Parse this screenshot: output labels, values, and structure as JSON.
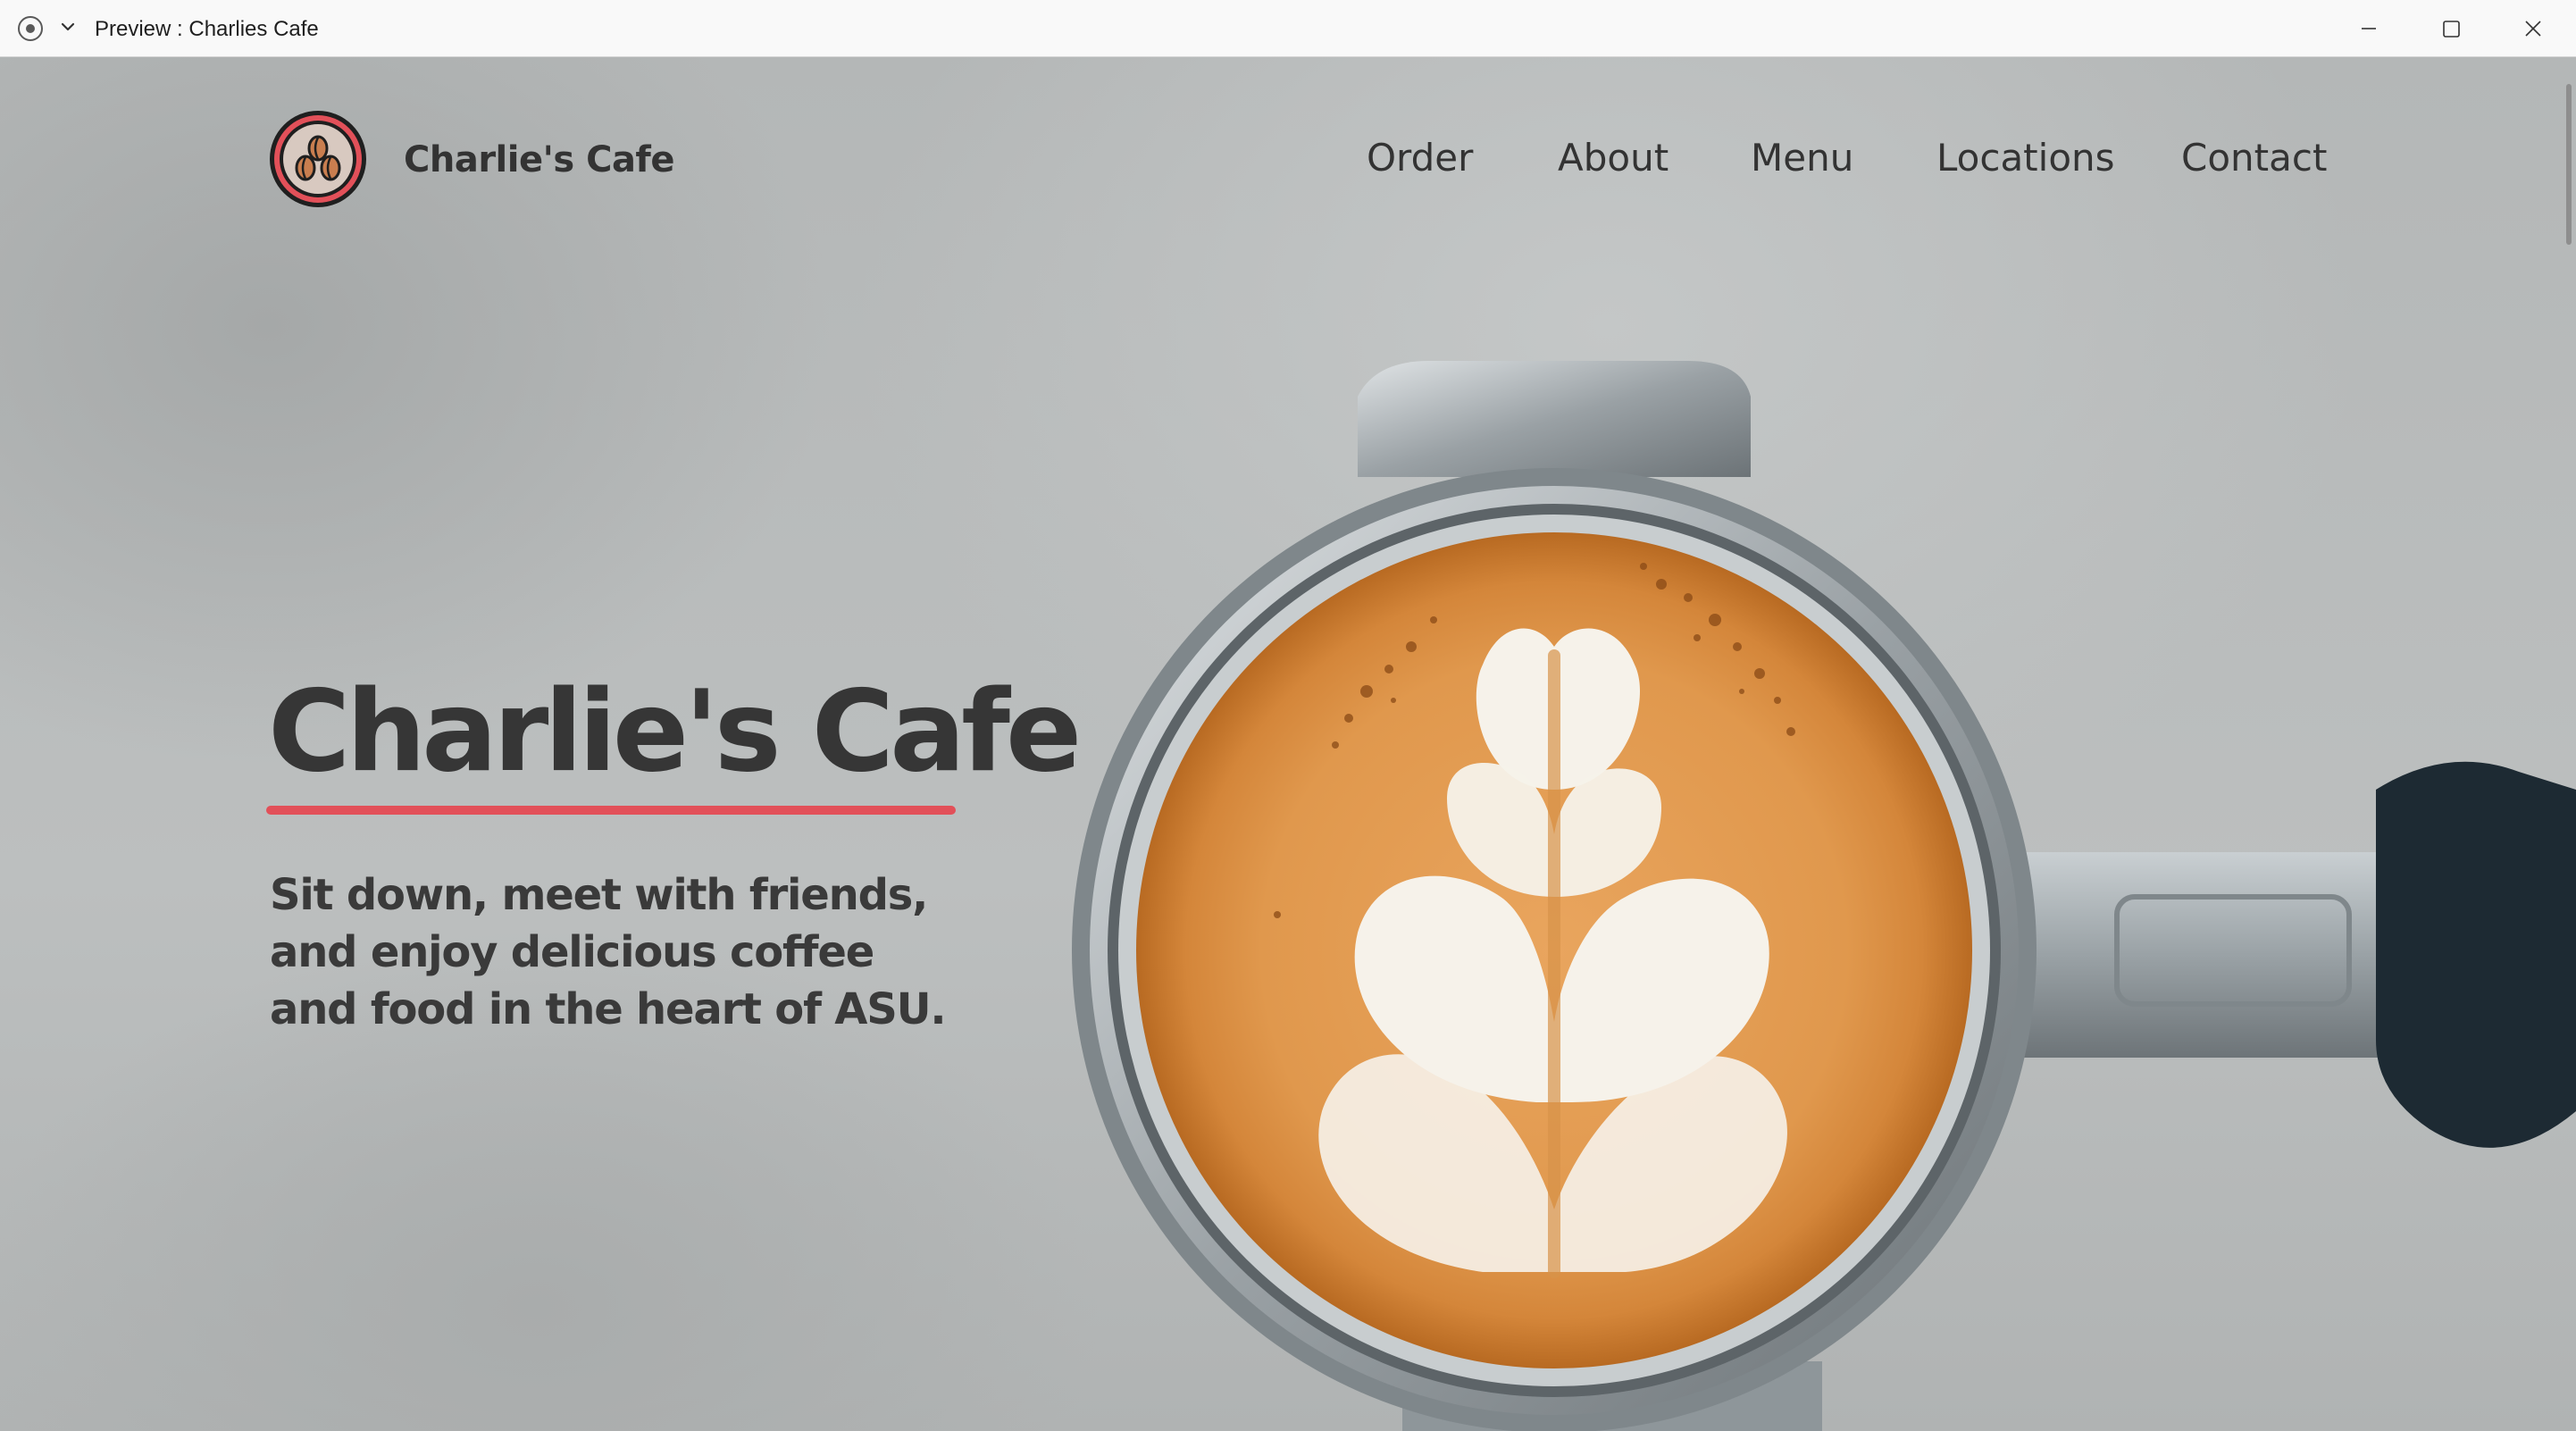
{
  "window": {
    "title": "Preview : Charlies Cafe",
    "app_icon": "record-icon",
    "controls": [
      "minimize-icon",
      "maximize-icon",
      "close-icon"
    ]
  },
  "site": {
    "brand": "Charlie's Cafe",
    "logo_icon": "coffee-beans-logo",
    "accent_color": "#e25059",
    "text_color": "#333333"
  },
  "nav": {
    "items": [
      {
        "label": "Order"
      },
      {
        "label": "About"
      },
      {
        "label": "Menu"
      },
      {
        "label": "Locations"
      },
      {
        "label": "Contact"
      }
    ]
  },
  "hero": {
    "title": "Charlie's Cafe",
    "tagline_lines": [
      "Sit down, meet with friends,",
      "and enjoy delicious coffee",
      "and food in the heart of ASU."
    ],
    "image": "latte-art-portafilter-photo"
  }
}
